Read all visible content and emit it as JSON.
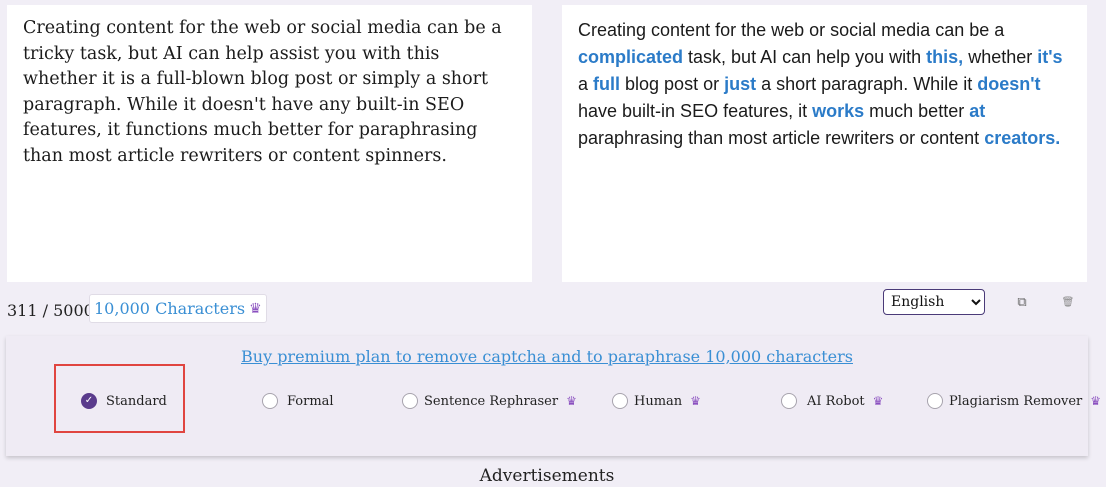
{
  "input_panel": {
    "text": "Creating content for the web or social media can be a tricky task, but AI can help assist you with this whether it is a full-blown blog post or simply a short paragraph. While it doesn't have any built-in SEO features, it functions much better for paraphrasing than most article rewriters or content spinners."
  },
  "output_panel": {
    "segments": [
      {
        "t": "Creating content for the web or social media can be a ",
        "h": false
      },
      {
        "t": "complicated",
        "h": true
      },
      {
        "t": " task, but AI can help you with ",
        "h": false
      },
      {
        "t": "this,",
        "h": true
      },
      {
        "t": " whether ",
        "h": false
      },
      {
        "t": "it's",
        "h": true
      },
      {
        "t": " a ",
        "h": false
      },
      {
        "t": "full",
        "h": true
      },
      {
        "t": " blog post or ",
        "h": false
      },
      {
        "t": "just",
        "h": true
      },
      {
        "t": " a short paragraph. While it ",
        "h": false
      },
      {
        "t": "doesn't",
        "h": true
      },
      {
        "t": " have built-in SEO features, it ",
        "h": false
      },
      {
        "t": "works",
        "h": true
      },
      {
        "t": " much better ",
        "h": false
      },
      {
        "t": "at",
        "h": true
      },
      {
        "t": " paraphrasing than most article rewriters or content ",
        "h": false
      },
      {
        "t": "creators.",
        "h": true
      }
    ]
  },
  "counter": {
    "text": "311 / 5000",
    "premium_limit": "10,000 Characters",
    "premium_icon": "crown-icon"
  },
  "language": {
    "selected": "English",
    "options": [
      "English"
    ]
  },
  "toolbar": {
    "copy_icon": "copy-icon",
    "delete_icon": "trash-icon"
  },
  "modes": {
    "premium_link": "Buy premium plan to remove captcha and to paraphrase 10,000 characters",
    "items": [
      {
        "label": "Standard",
        "checked": true,
        "premium": false
      },
      {
        "label": "Formal",
        "checked": false,
        "premium": false
      },
      {
        "label": "Sentence Rephraser",
        "checked": false,
        "premium": true
      },
      {
        "label": "Human",
        "checked": false,
        "premium": true
      },
      {
        "label": "AI Robot",
        "checked": false,
        "premium": true
      },
      {
        "label": "Plagiarism Remover",
        "checked": false,
        "premium": true
      }
    ]
  },
  "ads_label": "Advertisements",
  "colors": {
    "highlight_word": "#2b7bc8",
    "accent_purple": "#5a3b8c",
    "annotation_red": "#e04540"
  }
}
